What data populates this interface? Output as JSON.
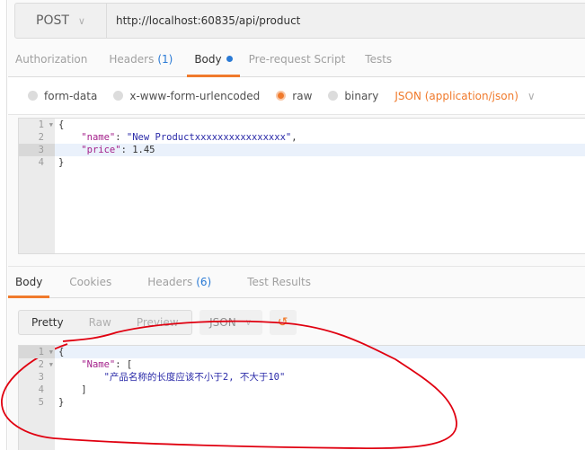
{
  "request": {
    "method": "POST",
    "url": "http://localhost:60835/api/product"
  },
  "request_tabs": [
    {
      "label": "Authorization",
      "count": null,
      "active": false
    },
    {
      "label": "Headers",
      "count": "(1)",
      "active": false
    },
    {
      "label": "Body",
      "count": null,
      "active": true,
      "dot": true
    },
    {
      "label": "Pre-request Script",
      "count": null,
      "active": false
    },
    {
      "label": "Tests",
      "count": null,
      "active": false
    }
  ],
  "body_modes": [
    {
      "label": "form-data",
      "selected": false
    },
    {
      "label": "x-www-form-urlencoded",
      "selected": false
    },
    {
      "label": "raw",
      "selected": true
    },
    {
      "label": "binary",
      "selected": false
    }
  ],
  "content_type": "JSON (application/json)",
  "request_body": {
    "lines": [
      "1",
      "2",
      "3",
      "4"
    ],
    "name_key": "\"name\"",
    "name_value": "\"New Productxxxxxxxxxxxxxxxx\"",
    "price_key": "\"price\"",
    "price_value": "1.45"
  },
  "response_tabs": [
    {
      "label": "Body",
      "count": null,
      "active": true
    },
    {
      "label": "Cookies",
      "count": null,
      "active": false
    },
    {
      "label": "Headers",
      "count": "(6)",
      "active": false
    },
    {
      "label": "Test Results",
      "count": null,
      "active": false
    }
  ],
  "response_view": {
    "modes": [
      "Pretty",
      "Raw",
      "Preview"
    ],
    "selected_mode": "Pretty",
    "format": "JSON"
  },
  "response_body": {
    "lines": [
      "1",
      "2",
      "3",
      "4",
      "5"
    ],
    "key": "\"Name\"",
    "message": "\"产品名称的长度应该不小于2, 不大于10\""
  },
  "colors": {
    "accent": "#f07a2c",
    "link_blue": "#2a7ad5",
    "annotation_red": "#e00010"
  }
}
